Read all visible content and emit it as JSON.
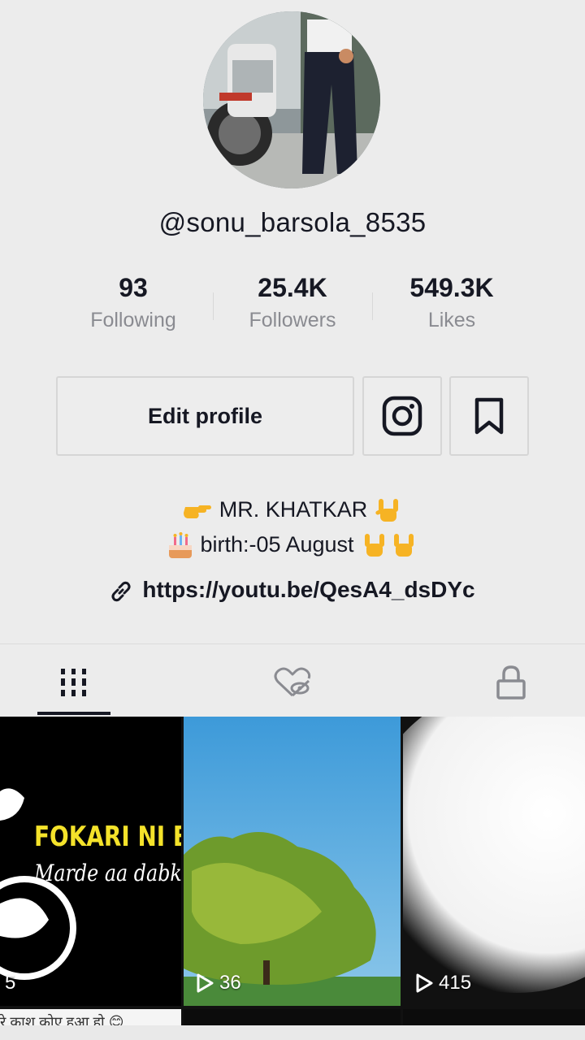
{
  "profile": {
    "username": "@sonu_barsola_8535"
  },
  "stats": [
    {
      "value": "93",
      "label": "Following"
    },
    {
      "value": "25.4K",
      "label": "Followers"
    },
    {
      "value": "549.3K",
      "label": "Likes"
    }
  ],
  "actions": {
    "edit_profile": "Edit profile",
    "instagram_icon": "instagram-icon",
    "bookmark_icon": "bookmark-icon"
  },
  "bio": {
    "line1": "MR. KHATKAR",
    "line2": "birth:-05 August",
    "link": "https://youtu.be/QesA4_dsDYc"
  },
  "tabs": [
    {
      "icon": "videos-grid-icon",
      "active": true
    },
    {
      "icon": "liked-hidden-icon",
      "active": false
    },
    {
      "icon": "lock-icon",
      "active": false
    }
  ],
  "videos": [
    {
      "views": "5",
      "overlay_title": "FOKARI NI BA",
      "overlay_sub": "Marde aa dabke"
    },
    {
      "views": "36"
    },
    {
      "views": "415"
    }
  ],
  "second_row": {
    "caption": "रे काश कोए हुआ हो 😊"
  },
  "colors": {
    "background": "#ececec",
    "text": "#161823",
    "muted": "#8a8b91",
    "overlay_yellow": "#f4e22a"
  }
}
